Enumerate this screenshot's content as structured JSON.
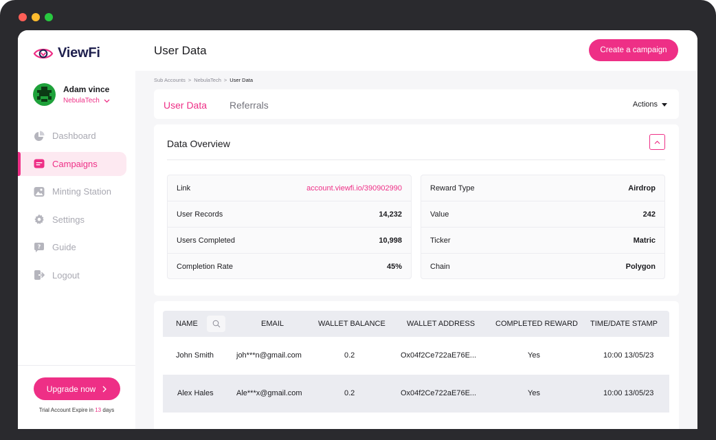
{
  "app": {
    "brand": "ViewFi",
    "page_title": "User Data",
    "create_button": "Create a campaign"
  },
  "profile": {
    "name": "Adam vince",
    "org": "NebulaTech"
  },
  "sidebar": {
    "items": [
      {
        "label": "Dashboard",
        "icon": "pie-chart-icon"
      },
      {
        "label": "Campaigns",
        "icon": "campaigns-icon",
        "active": true
      },
      {
        "label": "Minting Station",
        "icon": "image-icon"
      },
      {
        "label": "Settings",
        "icon": "gear-icon"
      },
      {
        "label": "Guide",
        "icon": "question-icon"
      },
      {
        "label": "Logout",
        "icon": "logout-icon"
      }
    ],
    "upgrade_button": "Upgrade now",
    "trial_prefix": "Trial Account Expire in",
    "trial_days": "13",
    "trial_suffix": "days"
  },
  "breadcrumb": [
    "Sub Accounts",
    "NebulaTech",
    "User Data"
  ],
  "breadcrumb_separator": ">",
  "tabs": [
    {
      "label": "User Data",
      "active": true
    },
    {
      "label": "Referrals",
      "active": false
    }
  ],
  "actions_label": "Actions",
  "overview": {
    "title": "Data Overview",
    "left": [
      {
        "label": "Link",
        "value": "account.viewfi.io/390902990"
      },
      {
        "label": "User Records",
        "value": "14,232"
      },
      {
        "label": "Users Completed",
        "value": "10,998"
      },
      {
        "label": "Completion Rate",
        "value": "45%"
      }
    ],
    "right": [
      {
        "label": "Reward Type",
        "value": "Airdrop"
      },
      {
        "label": "Value",
        "value": "242"
      },
      {
        "label": "Ticker",
        "value": "Matric"
      },
      {
        "label": "Chain",
        "value": "Polygon"
      }
    ]
  },
  "table": {
    "columns": [
      "NAME",
      "EMAIL",
      "WALLET BALANCE",
      "WALLET ADDRESS",
      "COMPLETED REWARD",
      "TIME/DATE STAMP"
    ],
    "rows": [
      {
        "name": "John Smith",
        "email": "joh***n@gmail.com",
        "balance": "0.2",
        "address": "Ox04f2Ce722aE76E...",
        "reward": "Yes",
        "timestamp": "10:00 13/05/23"
      },
      {
        "name": "Alex Hales",
        "email": "Ale***x@gmail.com",
        "balance": "0.2",
        "address": "Ox04f2Ce722aE76E...",
        "reward": "Yes",
        "timestamp": "10:00 13/05/23"
      }
    ]
  },
  "colors": {
    "accent": "#ee2f86",
    "brand_navy": "#1e1f4d",
    "inactive": "#a9a9b2"
  }
}
